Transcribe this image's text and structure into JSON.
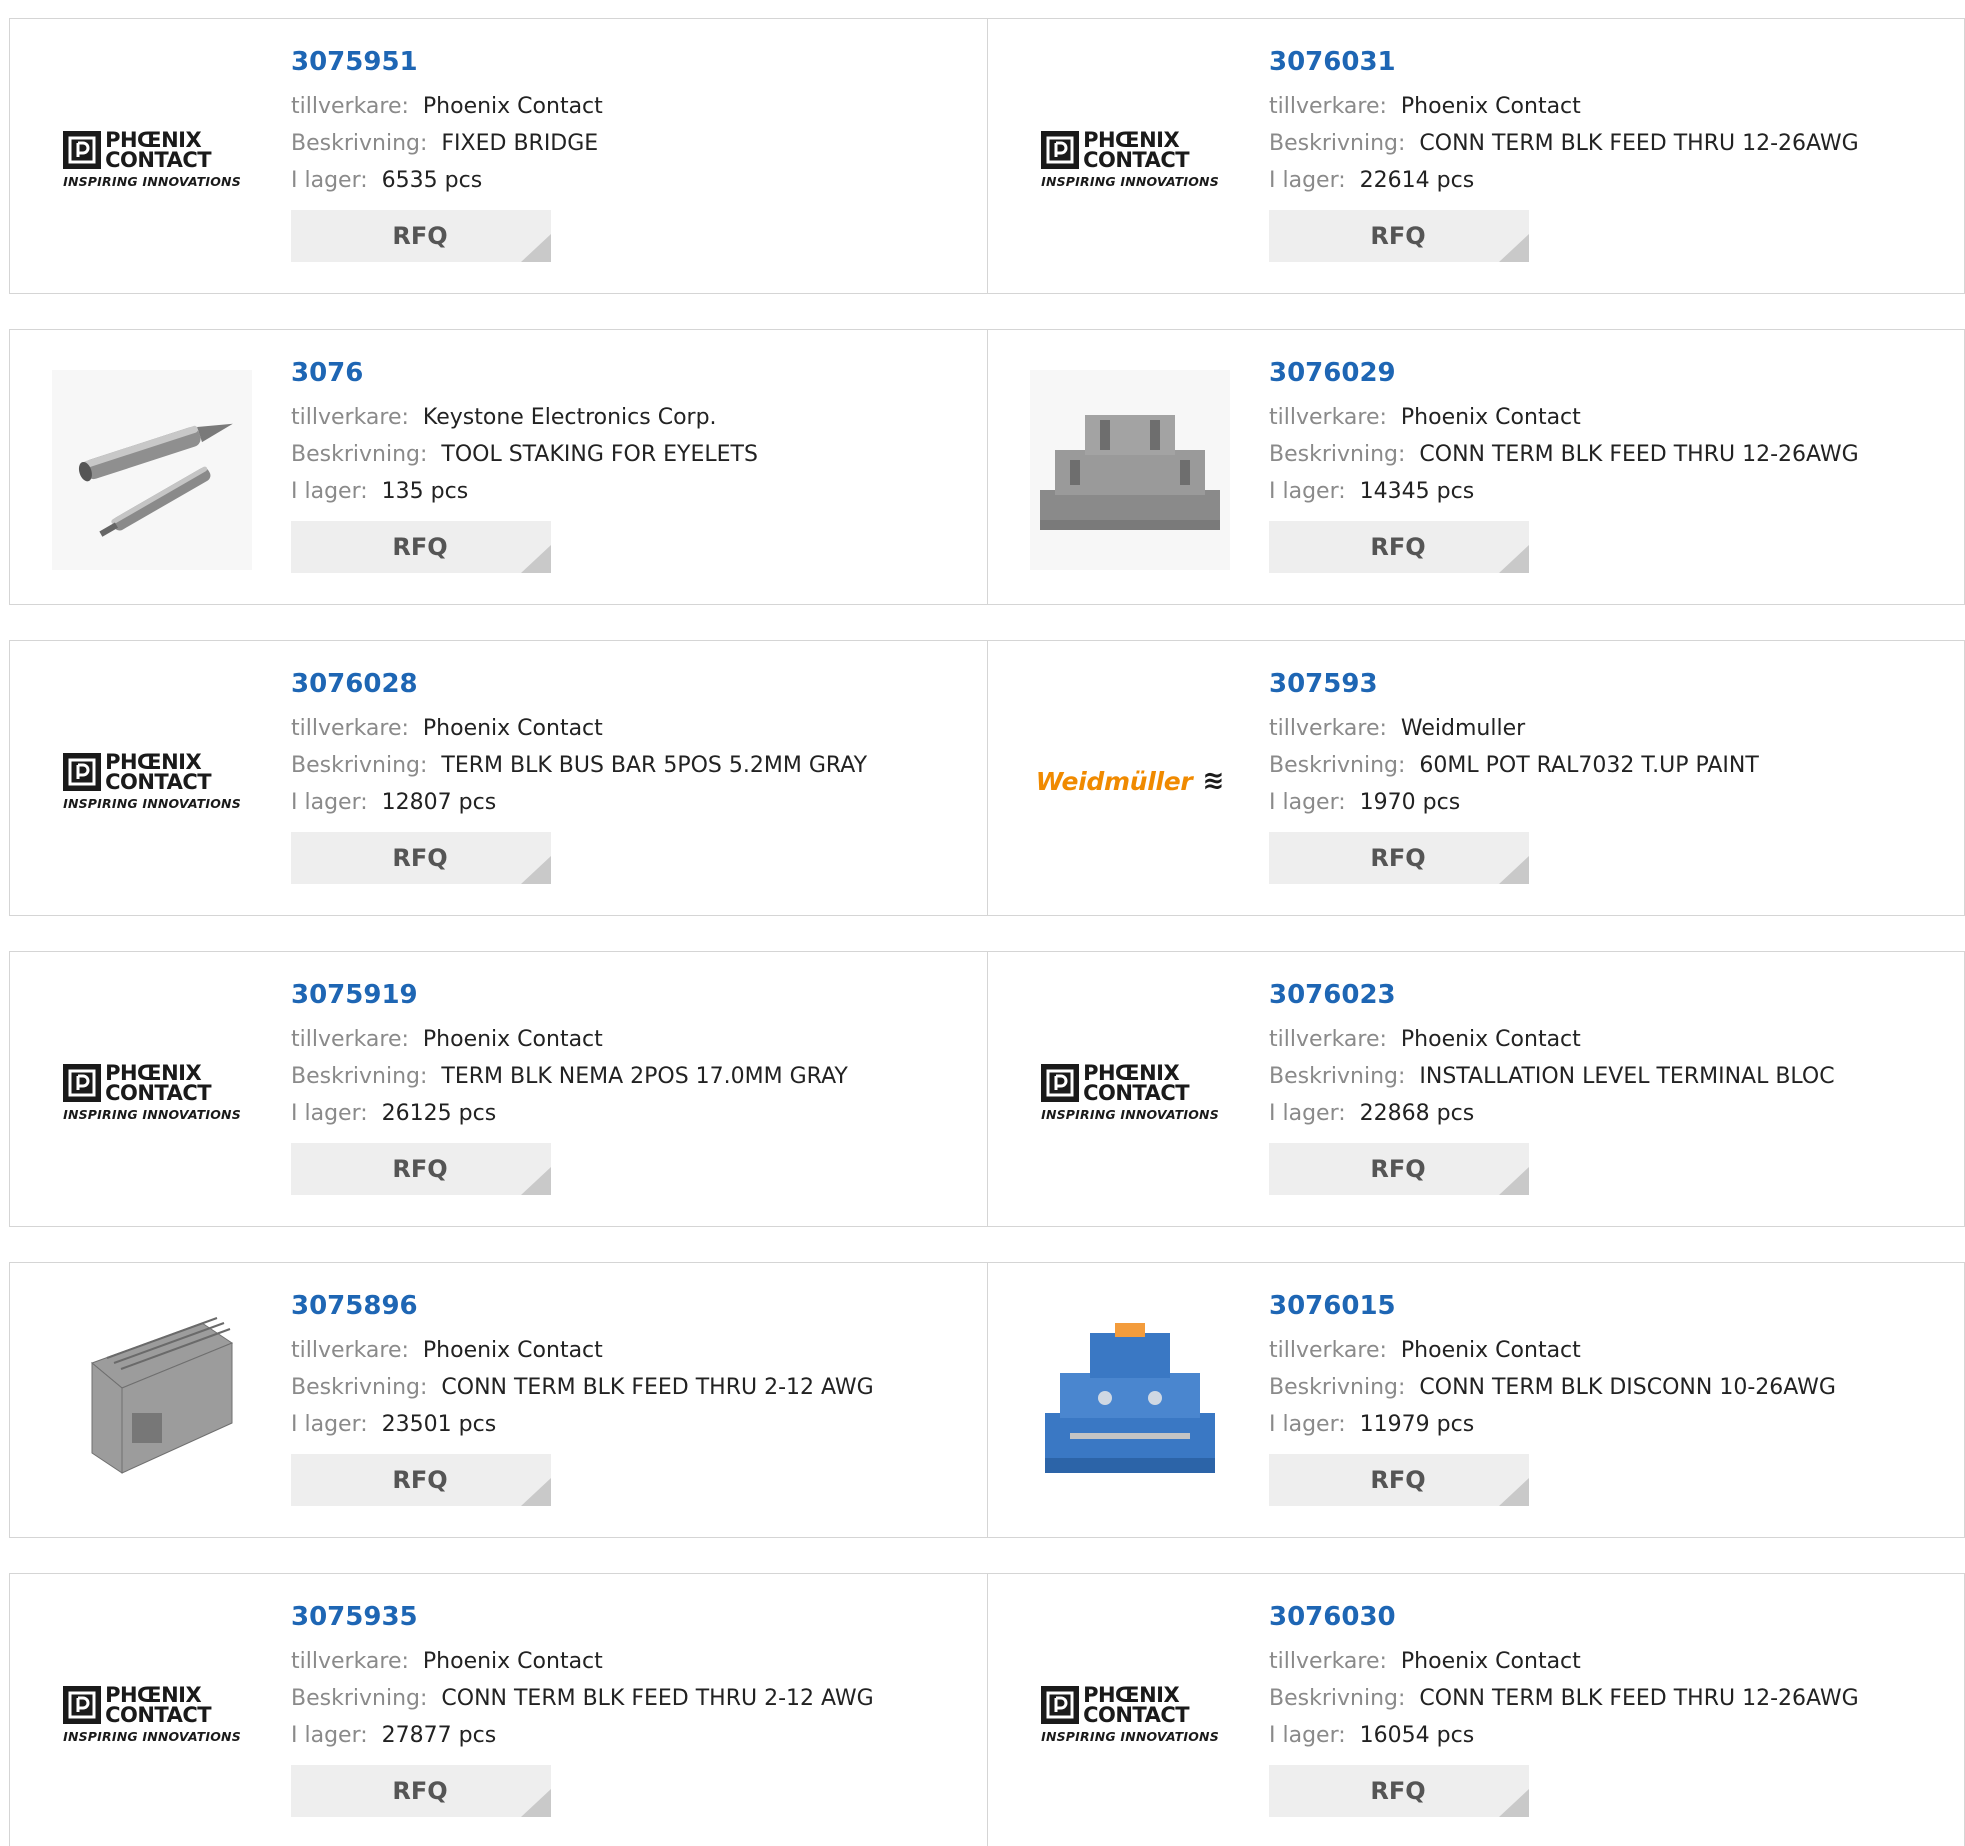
{
  "labels": {
    "manufacturer": "tillverkare:",
    "description": "Beskrivning:",
    "stock": "I lager:",
    "rfq": "RFQ"
  },
  "logos": {
    "phoenix_brand": "PHŒNIX CONTACT",
    "phoenix_line1": "PHŒNIX",
    "phoenix_line2": "CONTACT",
    "phoenix_tagline": "INSPIRING INNOVATIONS",
    "weidmuller_text": "Weidmüller",
    "weidmuller_symbol": "≋"
  },
  "products": [
    {
      "part": "3075951",
      "manufacturer": "Phoenix Contact",
      "description": "FIXED BRIDGE",
      "stock": "6535 pcs",
      "image": "phoenix-logo"
    },
    {
      "part": "3076031",
      "manufacturer": "Phoenix Contact",
      "description": "CONN TERM BLK FEED THRU 12-26AWG",
      "stock": "22614 pcs",
      "image": "phoenix-logo"
    },
    {
      "part": "3076",
      "manufacturer": "Keystone Electronics Corp.",
      "description": "TOOL STAKING FOR EYELETS",
      "stock": "135 pcs",
      "image": "staking-tool-photo"
    },
    {
      "part": "3076029",
      "manufacturer": "Phoenix Contact",
      "description": "CONN TERM BLK FEED THRU 12-26AWG",
      "stock": "14345 pcs",
      "image": "gray-terminal-block-photo"
    },
    {
      "part": "3076028",
      "manufacturer": "Phoenix Contact",
      "description": "TERM BLK BUS BAR 5POS 5.2MM GRAY",
      "stock": "12807 pcs",
      "image": "phoenix-logo"
    },
    {
      "part": "307593",
      "manufacturer": "Weidmuller",
      "description": "60ML POT RAL7032 T.UP PAINT",
      "stock": "1970 pcs",
      "image": "weidmuller-logo"
    },
    {
      "part": "3075919",
      "manufacturer": "Phoenix Contact",
      "description": "TERM BLK NEMA 2POS 17.0MM GRAY",
      "stock": "26125 pcs",
      "image": "phoenix-logo"
    },
    {
      "part": "3076023",
      "manufacturer": "Phoenix Contact",
      "description": "INSTALLATION LEVEL TERMINAL BLOC",
      "stock": "22868 pcs",
      "image": "phoenix-logo"
    },
    {
      "part": "3075896",
      "manufacturer": "Phoenix Contact",
      "description": "CONN TERM BLK FEED THRU 2-12 AWG",
      "stock": "23501 pcs",
      "image": "gray-terminal-strip-photo"
    },
    {
      "part": "3076015",
      "manufacturer": "Phoenix Contact",
      "description": "CONN TERM BLK DISCONN 10-26AWG",
      "stock": "11979 pcs",
      "image": "blue-terminal-block-photo"
    },
    {
      "part": "3075935",
      "manufacturer": "Phoenix Contact",
      "description": "CONN TERM BLK FEED THRU 2-12 AWG",
      "stock": "27877 pcs",
      "image": "phoenix-logo"
    },
    {
      "part": "3076030",
      "manufacturer": "Phoenix Contact",
      "description": "CONN TERM BLK FEED THRU 12-26AWG",
      "stock": "16054 pcs",
      "image": "phoenix-logo"
    }
  ],
  "colors": {
    "part_link": "#1e66b4",
    "label": "#8a8a8a",
    "border": "#d5d5d5",
    "button_bg": "#eeeeee",
    "weidmuller_orange": "#f08a00",
    "terminal_blue": "#3a78c4"
  }
}
